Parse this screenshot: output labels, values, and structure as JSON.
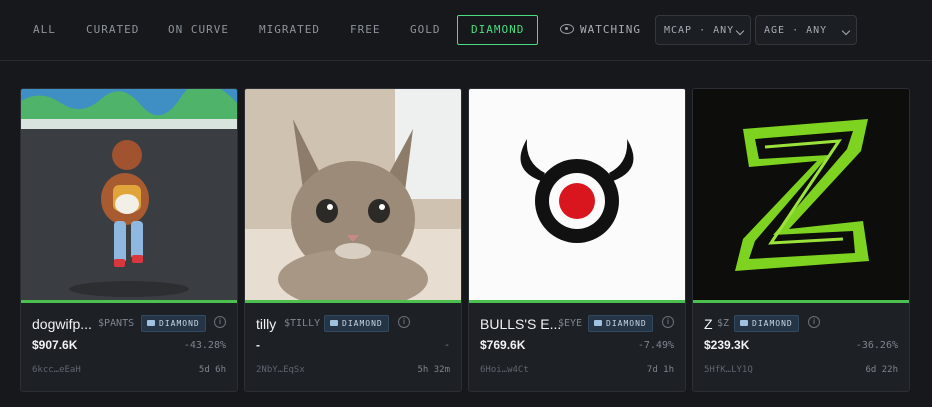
{
  "filters": {
    "tabs": [
      "ALL",
      "CURATED",
      "ON CURVE",
      "MIGRATED",
      "FREE",
      "GOLD",
      "DIAMOND"
    ],
    "active_tab": "DIAMOND",
    "watching_label": "WATCHING",
    "mcap_dropdown": "MCAP · ANY",
    "age_dropdown": "AGE · ANY"
  },
  "colors": {
    "accent": "#4ade80",
    "card_bar": "#4cc04f",
    "badge_bg": "#253546"
  },
  "cards": [
    {
      "name": "dogwifp...",
      "ticker": "$PANTS",
      "badge": "DIAMOND",
      "mcap": "$907.6K",
      "change": "-43.28%",
      "address": "6kcc…eEaH",
      "age": "5d 6h",
      "image": "dog-walking-photo"
    },
    {
      "name": "tilly",
      "ticker": "$TILLY",
      "badge": "DIAMOND",
      "mcap": "-",
      "change": "-",
      "address": "2NbY…EqSx",
      "age": "5h 32m",
      "image": "kitten-photo"
    },
    {
      "name": "BULLS'S E...",
      "ticker": "$EYE",
      "badge": "DIAMOND",
      "mcap": "$769.6K",
      "change": "-7.49%",
      "address": "6Hoi…w4Ct",
      "age": "7d 1h",
      "image": "bull-target-logo"
    },
    {
      "name": "Z",
      "ticker": "$Z",
      "badge": "DIAMOND",
      "mcap": "$239.3K",
      "change": "-36.26%",
      "address": "5HfK…LY1Q",
      "age": "6d 22h",
      "image": "green-z-logo"
    }
  ]
}
